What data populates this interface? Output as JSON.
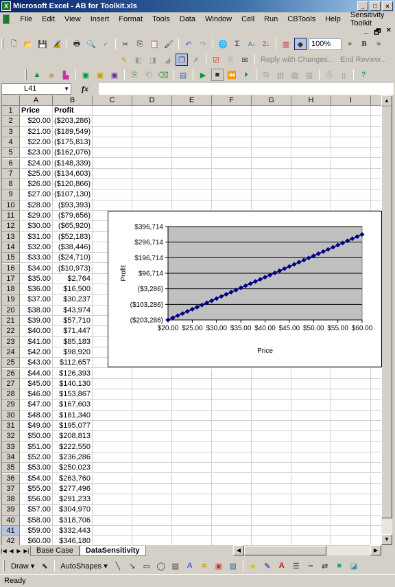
{
  "window": {
    "title": "Microsoft Excel - AB for Toolkit.xls",
    "buttons": [
      "_",
      "□",
      "×"
    ]
  },
  "menu": [
    "File",
    "Edit",
    "View",
    "Insert",
    "Format",
    "Tools",
    "Data",
    "Window",
    "Cell",
    "Run",
    "CBTools",
    "Help",
    "Sensitivity Toolkit"
  ],
  "doc_buttons": [
    "_",
    "🗗",
    "×"
  ],
  "toolbar": {
    "zoom": "100%",
    "reply_label": "Reply with Changes...",
    "end_review_label": "End Review...",
    "standard_icons": [
      "new",
      "open",
      "save",
      "permission",
      "print",
      "print-preview",
      "spelling",
      "cut",
      "copy",
      "paste",
      "format-painter",
      "undo",
      "redo",
      "hyperlink",
      "autosum",
      "sort-ascending",
      "sort-descending",
      "chart-wizard",
      "drawing"
    ],
    "bold": "B"
  },
  "formula_bar": {
    "name_box": "L41",
    "fx": "fx",
    "formula": ""
  },
  "columns": [
    "A",
    "B",
    "C",
    "D",
    "E",
    "F",
    "G",
    "H",
    "I"
  ],
  "header_row": {
    "A": "Price",
    "B": "Profit"
  },
  "rows": [
    {
      "n": "2",
      "price": "$20.00",
      "profit": "($203,286)"
    },
    {
      "n": "3",
      "price": "$21.00",
      "profit": "($189,549)"
    },
    {
      "n": "4",
      "price": "$22.00",
      "profit": "($175,813)"
    },
    {
      "n": "5",
      "price": "$23.00",
      "profit": "($162,076)"
    },
    {
      "n": "6",
      "price": "$24.00",
      "profit": "($148,339)"
    },
    {
      "n": "7",
      "price": "$25.00",
      "profit": "($134,603)"
    },
    {
      "n": "8",
      "price": "$26.00",
      "profit": "($120,866)"
    },
    {
      "n": "9",
      "price": "$27.00",
      "profit": "($107,130)"
    },
    {
      "n": "10",
      "price": "$28.00",
      "profit": "($93,393)"
    },
    {
      "n": "11",
      "price": "$29.00",
      "profit": "($79,656)"
    },
    {
      "n": "12",
      "price": "$30.00",
      "profit": "($65,920)"
    },
    {
      "n": "13",
      "price": "$31.00",
      "profit": "($52,183)"
    },
    {
      "n": "14",
      "price": "$32.00",
      "profit": "($38,446)"
    },
    {
      "n": "15",
      "price": "$33.00",
      "profit": "($24,710)"
    },
    {
      "n": "16",
      "price": "$34.00",
      "profit": "($10,973)"
    },
    {
      "n": "17",
      "price": "$35.00",
      "profit": "$2,764"
    },
    {
      "n": "18",
      "price": "$36.00",
      "profit": "$16,500"
    },
    {
      "n": "19",
      "price": "$37.00",
      "profit": "$30,237"
    },
    {
      "n": "20",
      "price": "$38.00",
      "profit": "$43,974"
    },
    {
      "n": "21",
      "price": "$39.00",
      "profit": "$57,710"
    },
    {
      "n": "22",
      "price": "$40.00",
      "profit": "$71,447"
    },
    {
      "n": "23",
      "price": "$41.00",
      "profit": "$85,183"
    },
    {
      "n": "24",
      "price": "$42.00",
      "profit": "$98,920"
    },
    {
      "n": "25",
      "price": "$43.00",
      "profit": "$112,657"
    },
    {
      "n": "26",
      "price": "$44.00",
      "profit": "$126,393"
    },
    {
      "n": "27",
      "price": "$45.00",
      "profit": "$140,130"
    },
    {
      "n": "28",
      "price": "$46.00",
      "profit": "$153,867"
    },
    {
      "n": "29",
      "price": "$47.00",
      "profit": "$167,603"
    },
    {
      "n": "30",
      "price": "$48.00",
      "profit": "$181,340"
    },
    {
      "n": "31",
      "price": "$49.00",
      "profit": "$195,077"
    },
    {
      "n": "32",
      "price": "$50.00",
      "profit": "$208,813"
    },
    {
      "n": "33",
      "price": "$51.00",
      "profit": "$222,550"
    },
    {
      "n": "34",
      "price": "$52.00",
      "profit": "$236,286"
    },
    {
      "n": "35",
      "price": "$53.00",
      "profit": "$250,023"
    },
    {
      "n": "36",
      "price": "$54.00",
      "profit": "$263,760"
    },
    {
      "n": "37",
      "price": "$55.00",
      "profit": "$277,496"
    },
    {
      "n": "38",
      "price": "$56.00",
      "profit": "$291,233"
    },
    {
      "n": "39",
      "price": "$57.00",
      "profit": "$304,970"
    },
    {
      "n": "40",
      "price": "$58.00",
      "profit": "$318,706"
    },
    {
      "n": "41",
      "price": "$59.00",
      "profit": "$332,443"
    },
    {
      "n": "42",
      "price": "$60.00",
      "profit": "$346,180"
    }
  ],
  "selected_row": "41",
  "sheet_tabs": [
    {
      "label": "Base Case",
      "active": false
    },
    {
      "label": "DataSensitivity",
      "active": true
    }
  ],
  "draw_toolbar": {
    "draw": "Draw ▾",
    "autoshapes": "AutoShapes ▾"
  },
  "status": "Ready",
  "colors": {
    "plot_bg": "#c0c0c0",
    "series": "#000080",
    "title_bar": "#0a246a"
  },
  "chart_data": {
    "type": "line",
    "title": "",
    "xlabel": "Price",
    "ylabel": "Profit",
    "x": [
      20,
      21,
      22,
      23,
      24,
      25,
      26,
      27,
      28,
      29,
      30,
      31,
      32,
      33,
      34,
      35,
      36,
      37,
      38,
      39,
      40,
      41,
      42,
      43,
      44,
      45,
      46,
      47,
      48,
      49,
      50,
      51,
      52,
      53,
      54,
      55,
      56,
      57,
      58,
      59,
      60
    ],
    "series": [
      {
        "name": "Profit",
        "values": [
          -203286,
          -189549,
          -175813,
          -162076,
          -148339,
          -134603,
          -120866,
          -107130,
          -93393,
          -79656,
          -65920,
          -52183,
          -38446,
          -24710,
          -10973,
          2764,
          16500,
          30237,
          43974,
          57710,
          71447,
          85183,
          98920,
          112657,
          126393,
          140130,
          153867,
          167603,
          181340,
          195077,
          208813,
          222550,
          236286,
          250023,
          263760,
          277496,
          291233,
          304970,
          318706,
          332443,
          346180
        ]
      }
    ],
    "xlim": [
      20,
      60
    ],
    "ylim": [
      -203286,
      396714
    ],
    "xticks": [
      "$20.00",
      "$25.00",
      "$30.00",
      "$35.00",
      "$40.00",
      "$45.00",
      "$50.00",
      "$55.00",
      "$60.00"
    ],
    "xtick_values": [
      20,
      25,
      30,
      35,
      40,
      45,
      50,
      55,
      60
    ],
    "yticks": [
      "($203,286)",
      "($103,286)",
      "($3,286)",
      "$96,714",
      "$196,714",
      "$296,714",
      "$396,714"
    ],
    "ytick_values": [
      -203286,
      -103286,
      -3286,
      96714,
      196714,
      296714,
      396714
    ],
    "grid": "horizontal",
    "legend": "none",
    "marker": "diamond"
  }
}
